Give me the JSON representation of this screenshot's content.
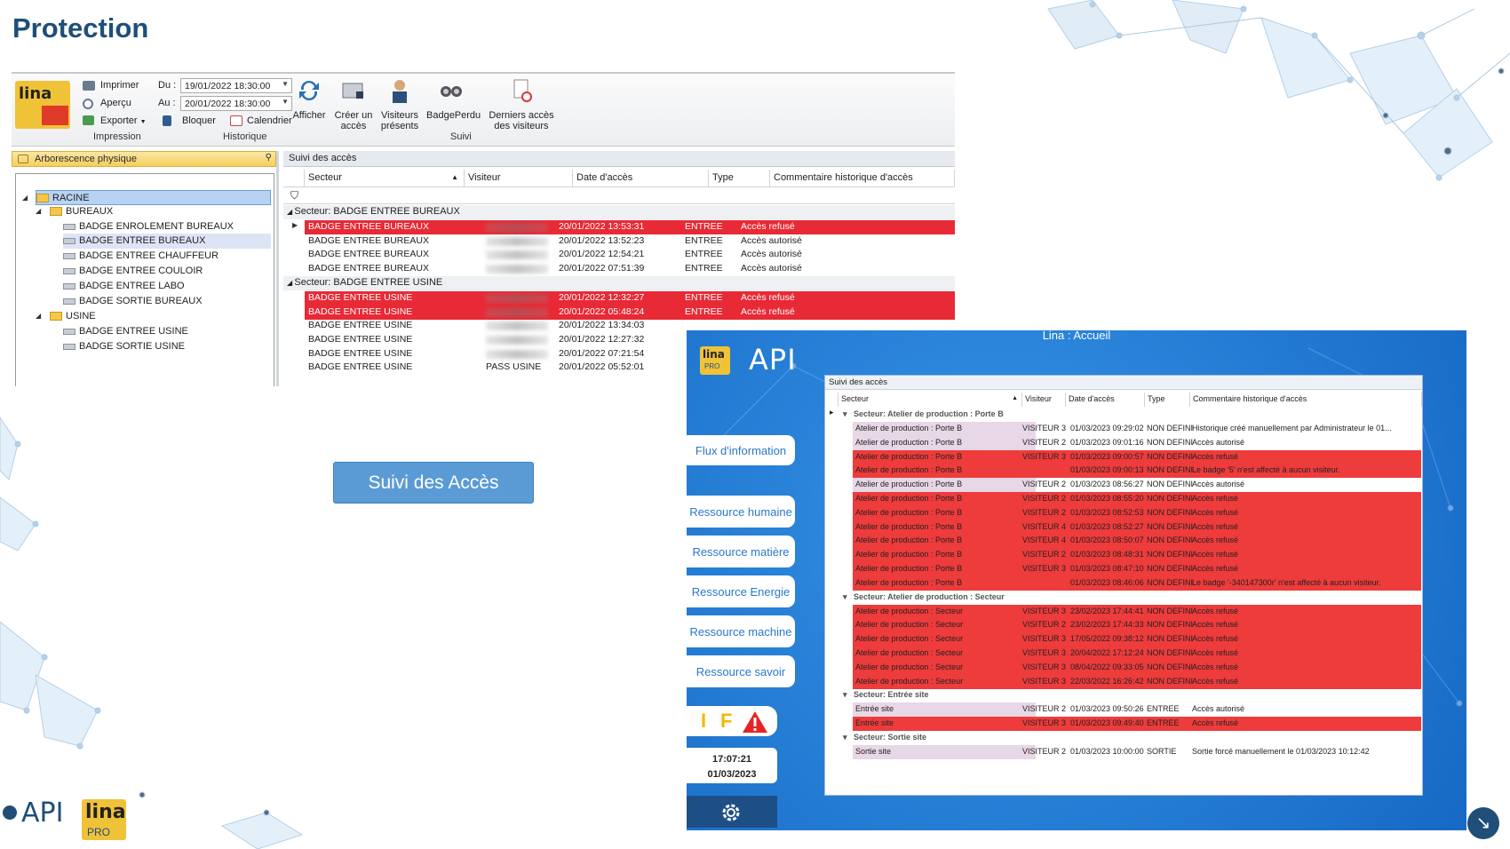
{
  "slide": {
    "title": "Protection",
    "cta_label": "Suivi des Accès"
  },
  "app1": {
    "logo_text": "lina",
    "ribbon": {
      "print": "Imprimer",
      "preview": "Aperçu",
      "export": "Exporter",
      "group_print": "Impression",
      "du_label": "Du :",
      "au_label": "Au :",
      "du_value": "19/01/2022 18:30:00",
      "au_value": "20/01/2022 18:30:00",
      "block": "Bloquer",
      "calendar": "Calendrier",
      "group_history": "Historique",
      "show": "Afficher",
      "create_line1": "Créer un",
      "create_line2": "accès",
      "visitors_line1": "Visiteurs",
      "visitors_line2": "présents",
      "badge_lost": "BadgePerdu",
      "last_line1": "Derniers accès",
      "last_line2": "des visiteurs",
      "group_follow": "Suivi"
    },
    "tree": {
      "title": "Arborescence physique",
      "nodes": [
        {
          "label": "RACINE"
        },
        {
          "label": "BUREAUX"
        },
        {
          "label": "BADGE ENROLEMENT BUREAUX"
        },
        {
          "label": "BADGE ENTREE BUREAUX"
        },
        {
          "label": "BADGE ENTREE CHAUFFEUR"
        },
        {
          "label": "BADGE ENTREE COULOIR"
        },
        {
          "label": "BADGE ENTREE LABO"
        },
        {
          "label": "BADGE SORTIE BUREAUX"
        },
        {
          "label": "USINE"
        },
        {
          "label": "BADGE ENTREE USINE"
        },
        {
          "label": "BADGE SORTIE USINE"
        }
      ]
    },
    "grid": {
      "title": "Suivi des accès",
      "columns": [
        "Secteur",
        "Visiteur",
        "Date d'accès",
        "Type",
        "Commentaire historique d'accès"
      ],
      "groups": [
        {
          "label": "Secteur: BADGE ENTREE BUREAUX",
          "rows": [
            {
              "secteur": "BADGE ENTREE BUREAUX",
              "visiteur": "",
              "date": "20/01/2022 13:53:31",
              "type": "ENTREE",
              "comment": "Accès refusé",
              "refused": true
            },
            {
              "secteur": "BADGE ENTREE BUREAUX",
              "visiteur": "",
              "date": "20/01/2022 13:52:23",
              "type": "ENTREE",
              "comment": "Accès autorisé",
              "refused": false
            },
            {
              "secteur": "BADGE ENTREE BUREAUX",
              "visiteur": "",
              "date": "20/01/2022 12:54:21",
              "type": "ENTREE",
              "comment": "Accès autorisé",
              "refused": false
            },
            {
              "secteur": "BADGE ENTREE BUREAUX",
              "visiteur": "",
              "date": "20/01/2022 07:51:39",
              "type": "ENTREE",
              "comment": "Accès autorisé",
              "refused": false
            }
          ]
        },
        {
          "label": "Secteur: BADGE ENTREE USINE",
          "rows": [
            {
              "secteur": "BADGE ENTREE USINE",
              "visiteur": "",
              "date": "20/01/2022 12:32:27",
              "type": "ENTREE",
              "comment": "Accès refusé",
              "refused": true
            },
            {
              "secteur": "BADGE ENTREE USINE",
              "visiteur": "",
              "date": "20/01/2022 05:48:24",
              "type": "ENTREE",
              "comment": "Accès refusé",
              "refused": true
            },
            {
              "secteur": "BADGE ENTREE USINE",
              "visiteur": "",
              "date": "20/01/2022 13:34:03",
              "type": "",
              "comment": "",
              "refused": false
            },
            {
              "secteur": "BADGE ENTREE USINE",
              "visiteur": "",
              "date": "20/01/2022 12:27:32",
              "type": "",
              "comment": "",
              "refused": false
            },
            {
              "secteur": "BADGE ENTREE USINE",
              "visiteur": "",
              "date": "20/01/2022 07:21:54",
              "type": "",
              "comment": "",
              "refused": false
            },
            {
              "secteur": "BADGE ENTREE USINE",
              "visiteur": "PASS USINE",
              "date": "20/01/2022 05:52:01",
              "type": "",
              "comment": "",
              "refused": false
            }
          ]
        }
      ]
    }
  },
  "app2": {
    "window_title": "Lina : Accueil",
    "logo_lina": "lina",
    "logo_pro": "PRO",
    "logo_api": "API",
    "menu": [
      "Flux d'information",
      "Ressource humaine",
      "Ressource matière",
      "Ressource Energie",
      "Ressource machine",
      "Ressource savoir"
    ],
    "status_letters": [
      "I",
      "F"
    ],
    "time": "17:07:21",
    "date": "01/03/2023",
    "panel_title": "Suivi des accès",
    "columns": [
      "Secteur",
      "Visiteur",
      "Date d'accès",
      "Type",
      "Commentaire historique d'accès"
    ],
    "groups": [
      {
        "label": "Secteur: Atelier de production : Porte B",
        "rows": [
          {
            "s": "Atelier de production : Porte B",
            "v": "VISITEUR 3",
            "d": "01/03/2023 09:29:02",
            "t": "NON DEFINI",
            "c": "Historique créé manuellement par Administrateur le 01...",
            "r": false
          },
          {
            "s": "Atelier de production : Porte B",
            "v": "VISITEUR 2",
            "d": "01/03/2023 09:01:16",
            "t": "NON DEFINI",
            "c": "Accès autorisé",
            "r": false
          },
          {
            "s": "Atelier de production : Porte B",
            "v": "VISITEUR 3",
            "d": "01/03/2023 09:00:57",
            "t": "NON DEFINI",
            "c": "Accès refusé",
            "r": true
          },
          {
            "s": "Atelier de production : Porte B",
            "v": "",
            "d": "01/03/2023 09:00:13",
            "t": "NON DEFINI",
            "c": "Le badge '5' n'est affecté à aucun visiteur.",
            "r": true
          },
          {
            "s": "Atelier de production : Porte B",
            "v": "VISITEUR 2",
            "d": "01/03/2023 08:56:27",
            "t": "NON DEFINI",
            "c": "Accès autorisé",
            "r": false
          },
          {
            "s": "Atelier de production : Porte B",
            "v": "VISITEUR 2",
            "d": "01/03/2023 08:55:20",
            "t": "NON DEFINI",
            "c": "Accès refusé",
            "r": true
          },
          {
            "s": "Atelier de production : Porte B",
            "v": "VISITEUR 2",
            "d": "01/03/2023 08:52:53",
            "t": "NON DEFINI",
            "c": "Accès refusé",
            "r": true
          },
          {
            "s": "Atelier de production : Porte B",
            "v": "VISITEUR 4",
            "d": "01/03/2023 08:52:27",
            "t": "NON DEFINI",
            "c": "Accès refusé",
            "r": true
          },
          {
            "s": "Atelier de production : Porte B",
            "v": "VISITEUR 4",
            "d": "01/03/2023 08:50:07",
            "t": "NON DEFINI",
            "c": "Accès refusé",
            "r": true
          },
          {
            "s": "Atelier de production : Porte B",
            "v": "VISITEUR 2",
            "d": "01/03/2023 08:48:31",
            "t": "NON DEFINI",
            "c": "Accès refusé",
            "r": true
          },
          {
            "s": "Atelier de production : Porte B",
            "v": "VISITEUR 3",
            "d": "01/03/2023 08:47:10",
            "t": "NON DEFINI",
            "c": "Accès refusé",
            "r": true
          },
          {
            "s": "Atelier de production : Porte B",
            "v": "",
            "d": "01/03/2023 08:46:06",
            "t": "NON DEFINI",
            "c": "Le badge '-340147300r' n'est affecté à aucun visiteur.",
            "r": true
          }
        ]
      },
      {
        "label": "Secteur: Atelier de production : Secteur",
        "rows": [
          {
            "s": "Atelier de production : Secteur",
            "v": "VISITEUR 3",
            "d": "23/02/2023 17:44:41",
            "t": "NON DEFINI",
            "c": "Accès refusé",
            "r": true
          },
          {
            "s": "Atelier de production : Secteur",
            "v": "VISITEUR 2",
            "d": "23/02/2023 17:44:33",
            "t": "NON DEFINI",
            "c": "Accès refusé",
            "r": true
          },
          {
            "s": "Atelier de production : Secteur",
            "v": "VISITEUR 3",
            "d": "17/05/2022 09:38:12",
            "t": "NON DEFINI",
            "c": "Accès refusé",
            "r": true
          },
          {
            "s": "Atelier de production : Secteur",
            "v": "VISITEUR 3",
            "d": "20/04/2022 17:12:24",
            "t": "NON DEFINI",
            "c": "Accès refusé",
            "r": true
          },
          {
            "s": "Atelier de production : Secteur",
            "v": "VISITEUR 3",
            "d": "08/04/2022 09:33:05",
            "t": "NON DEFINI",
            "c": "Accès refusé",
            "r": true
          },
          {
            "s": "Atelier de production : Secteur",
            "v": "VISITEUR 3",
            "d": "22/03/2022 16:26:42",
            "t": "NON DEFINI",
            "c": "Accès refusé",
            "r": true
          }
        ]
      },
      {
        "label": "Secteur: Entrée site",
        "rows": [
          {
            "s": "Entrée site",
            "v": "VISITEUR 2",
            "d": "01/03/2023 09:50:26",
            "t": "ENTREE",
            "c": "Accès autorisé",
            "r": false
          },
          {
            "s": "Entrée site",
            "v": "VISITEUR 3",
            "d": "01/03/2023 09:49:40",
            "t": "ENTREE",
            "c": "Accès refusé",
            "r": true
          }
        ]
      },
      {
        "label": "Secteur: Sortie site",
        "rows": [
          {
            "s": "Sortie site",
            "v": "VISITEUR 2",
            "d": "01/03/2023 10:00:00",
            "t": "SORTIE",
            "c": "Sortie forcé manuellement le 01/03/2023 10:12:42",
            "r": false
          }
        ]
      }
    ]
  },
  "footer": {
    "api_logo": "API",
    "lina_logo": "lina",
    "lina_pro": "PRO"
  },
  "colors": {
    "title": "#1f4e79",
    "refused_row": "#e72a36",
    "app2_bg": "#1769c4",
    "cta": "#5b9bd5"
  }
}
